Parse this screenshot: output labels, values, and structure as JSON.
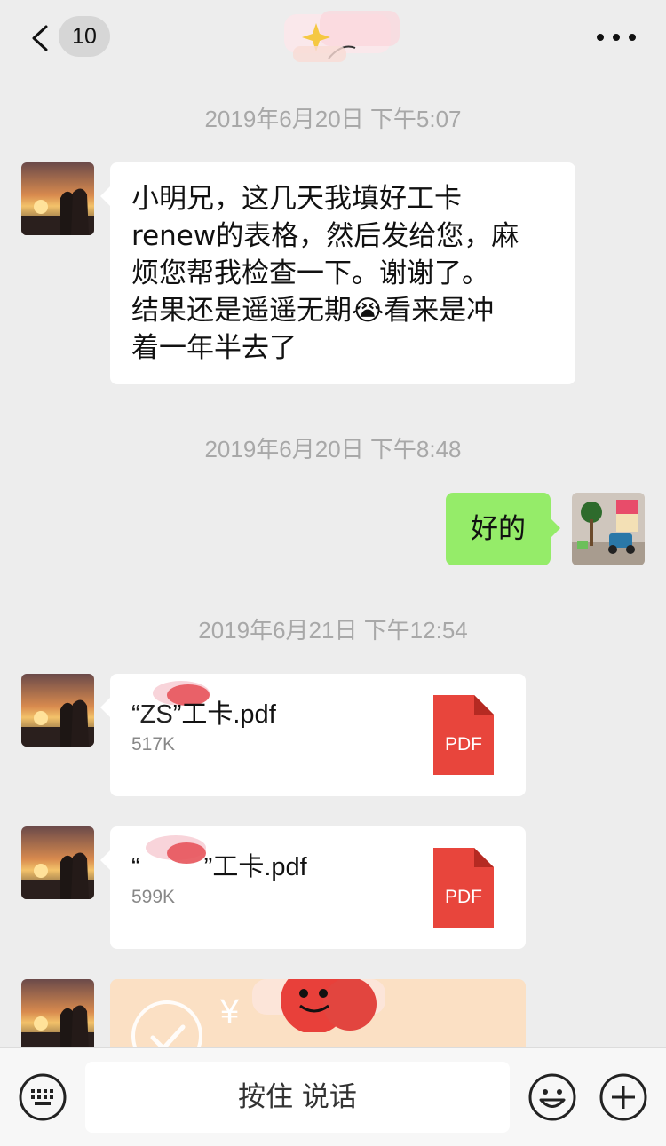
{
  "header": {
    "back_icon": "chevron-left-icon",
    "unread_count": "10",
    "more_icon": "more-dots-icon"
  },
  "timestamps": [
    "2019年6月20日 下午5:07",
    "2019年6月20日 下午8:48",
    "2019年6月21日 下午12:54"
  ],
  "messages": [
    {
      "lines": [
        "小明兄，这几天我填好工卡",
        "renew的表格，然后发给您，麻",
        "烦您帮我检查一下。谢谢了。",
        "结果还是遥遥无期",
        "看来是冲",
        "着一年半去了"
      ],
      "emoji": "😭"
    },
    {
      "text": "好的"
    },
    {
      "file_name": "”工卡.pdf",
      "file_prefix": "“ZS",
      "file_size": "517K",
      "icon_label": "PDF"
    },
    {
      "file_name": "”工卡.pdf",
      "file_prefix": "“",
      "file_size": "599K",
      "icon_label": "PDF"
    }
  ],
  "transfer": {
    "amount_prefix": "¥"
  },
  "input_bar": {
    "voice_label": "按住 说话",
    "keyboard_icon": "keyboard-icon",
    "emoji_icon": "emoji-face-icon",
    "plus_icon": "plus-circle-icon"
  },
  "colors": {
    "background": "#ededed",
    "sent_bubble": "#95ec69",
    "received_bubble": "#ffffff",
    "pdf_red": "#e8453c",
    "transfer_bg": "#fbe0c4"
  }
}
